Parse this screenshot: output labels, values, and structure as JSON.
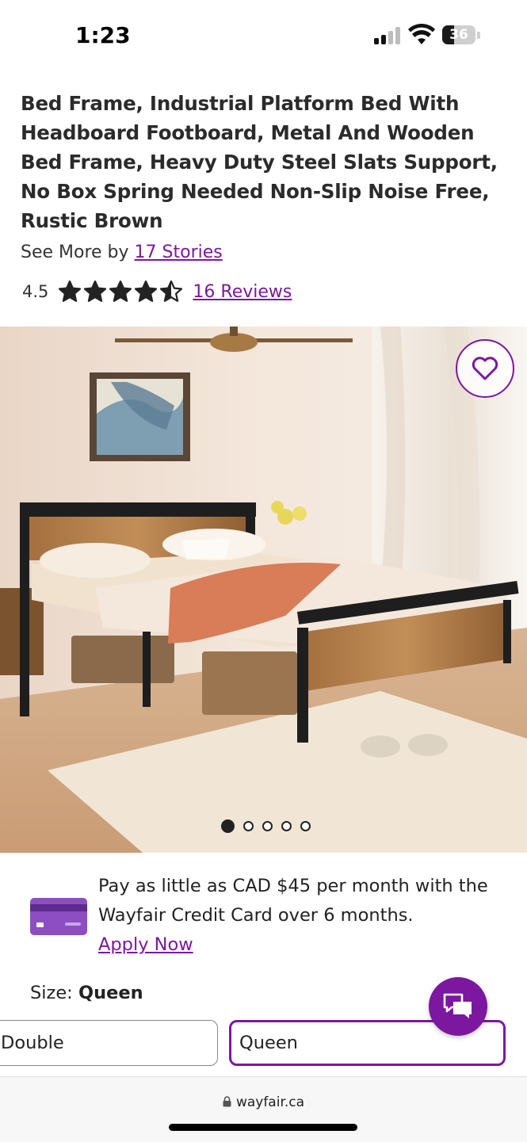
{
  "status_bar": {
    "time": "1:23",
    "battery": "36"
  },
  "product": {
    "title": "Bed Frame, Industrial Platform Bed With Headboard Footboard, Metal And Wooden Bed Frame, Heavy Duty Steel Slats Support, No Box Spring Needed Non-Slip Noise Free, Rustic Brown",
    "see_more_prefix": "See More by",
    "brand": "17 Stories",
    "rating": "4.5",
    "rating_value": 4.5,
    "reviews_link": "16 Reviews"
  },
  "gallery": {
    "image_count": 5,
    "active_index": 0
  },
  "credit": {
    "text": "Pay as little as CAD $45 per month with the Wayfair Credit Card over 6 months.",
    "link": "Apply Now"
  },
  "size": {
    "label": "Size:",
    "selected": "Queen",
    "options": [
      "Double",
      "Queen"
    ]
  },
  "browser": {
    "url": "wayfair.ca"
  },
  "colors": {
    "accent": "#7b189f"
  }
}
